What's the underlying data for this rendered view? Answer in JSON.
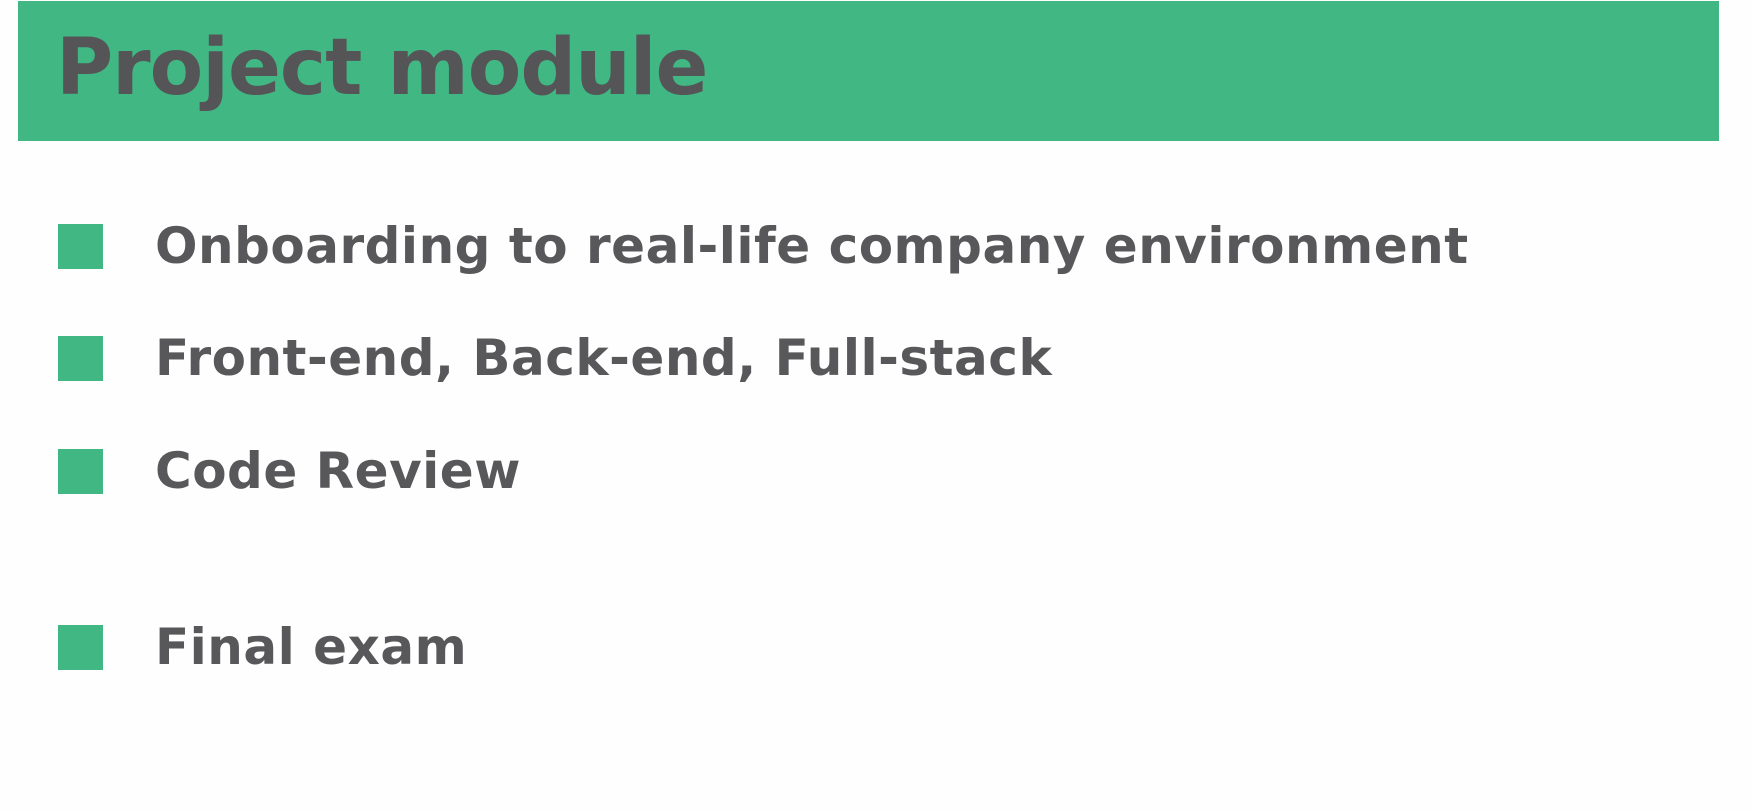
{
  "header": {
    "title": "Project module",
    "background_color": "#41b883"
  },
  "bullets": {
    "marker": "square",
    "marker_color": "#41b883",
    "items": [
      {
        "label": "Onboarding to real-life company environment"
      },
      {
        "label": "Front-end, Back-end, Full-stack"
      },
      {
        "label": "Code Review"
      },
      {
        "label": "Final exam"
      }
    ]
  }
}
